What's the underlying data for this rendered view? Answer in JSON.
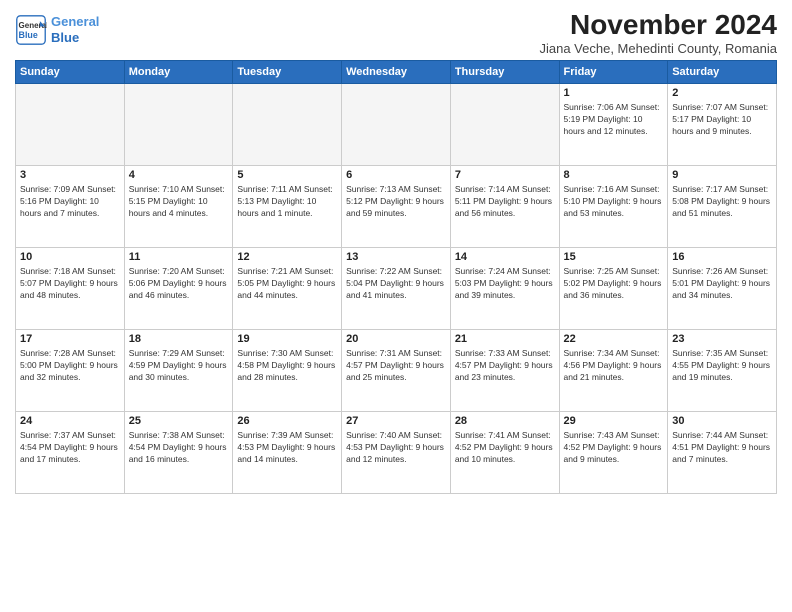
{
  "header": {
    "logo_line1": "General",
    "logo_line2": "Blue",
    "title": "November 2024",
    "location": "Jiana Veche, Mehedinti County, Romania"
  },
  "weekdays": [
    "Sunday",
    "Monday",
    "Tuesday",
    "Wednesday",
    "Thursday",
    "Friday",
    "Saturday"
  ],
  "weeks": [
    [
      {
        "day": "",
        "info": ""
      },
      {
        "day": "",
        "info": ""
      },
      {
        "day": "",
        "info": ""
      },
      {
        "day": "",
        "info": ""
      },
      {
        "day": "",
        "info": ""
      },
      {
        "day": "1",
        "info": "Sunrise: 7:06 AM\nSunset: 5:19 PM\nDaylight: 10 hours\nand 12 minutes."
      },
      {
        "day": "2",
        "info": "Sunrise: 7:07 AM\nSunset: 5:17 PM\nDaylight: 10 hours\nand 9 minutes."
      }
    ],
    [
      {
        "day": "3",
        "info": "Sunrise: 7:09 AM\nSunset: 5:16 PM\nDaylight: 10 hours\nand 7 minutes."
      },
      {
        "day": "4",
        "info": "Sunrise: 7:10 AM\nSunset: 5:15 PM\nDaylight: 10 hours\nand 4 minutes."
      },
      {
        "day": "5",
        "info": "Sunrise: 7:11 AM\nSunset: 5:13 PM\nDaylight: 10 hours\nand 1 minute."
      },
      {
        "day": "6",
        "info": "Sunrise: 7:13 AM\nSunset: 5:12 PM\nDaylight: 9 hours\nand 59 minutes."
      },
      {
        "day": "7",
        "info": "Sunrise: 7:14 AM\nSunset: 5:11 PM\nDaylight: 9 hours\nand 56 minutes."
      },
      {
        "day": "8",
        "info": "Sunrise: 7:16 AM\nSunset: 5:10 PM\nDaylight: 9 hours\nand 53 minutes."
      },
      {
        "day": "9",
        "info": "Sunrise: 7:17 AM\nSunset: 5:08 PM\nDaylight: 9 hours\nand 51 minutes."
      }
    ],
    [
      {
        "day": "10",
        "info": "Sunrise: 7:18 AM\nSunset: 5:07 PM\nDaylight: 9 hours\nand 48 minutes."
      },
      {
        "day": "11",
        "info": "Sunrise: 7:20 AM\nSunset: 5:06 PM\nDaylight: 9 hours\nand 46 minutes."
      },
      {
        "day": "12",
        "info": "Sunrise: 7:21 AM\nSunset: 5:05 PM\nDaylight: 9 hours\nand 44 minutes."
      },
      {
        "day": "13",
        "info": "Sunrise: 7:22 AM\nSunset: 5:04 PM\nDaylight: 9 hours\nand 41 minutes."
      },
      {
        "day": "14",
        "info": "Sunrise: 7:24 AM\nSunset: 5:03 PM\nDaylight: 9 hours\nand 39 minutes."
      },
      {
        "day": "15",
        "info": "Sunrise: 7:25 AM\nSunset: 5:02 PM\nDaylight: 9 hours\nand 36 minutes."
      },
      {
        "day": "16",
        "info": "Sunrise: 7:26 AM\nSunset: 5:01 PM\nDaylight: 9 hours\nand 34 minutes."
      }
    ],
    [
      {
        "day": "17",
        "info": "Sunrise: 7:28 AM\nSunset: 5:00 PM\nDaylight: 9 hours\nand 32 minutes."
      },
      {
        "day": "18",
        "info": "Sunrise: 7:29 AM\nSunset: 4:59 PM\nDaylight: 9 hours\nand 30 minutes."
      },
      {
        "day": "19",
        "info": "Sunrise: 7:30 AM\nSunset: 4:58 PM\nDaylight: 9 hours\nand 28 minutes."
      },
      {
        "day": "20",
        "info": "Sunrise: 7:31 AM\nSunset: 4:57 PM\nDaylight: 9 hours\nand 25 minutes."
      },
      {
        "day": "21",
        "info": "Sunrise: 7:33 AM\nSunset: 4:57 PM\nDaylight: 9 hours\nand 23 minutes."
      },
      {
        "day": "22",
        "info": "Sunrise: 7:34 AM\nSunset: 4:56 PM\nDaylight: 9 hours\nand 21 minutes."
      },
      {
        "day": "23",
        "info": "Sunrise: 7:35 AM\nSunset: 4:55 PM\nDaylight: 9 hours\nand 19 minutes."
      }
    ],
    [
      {
        "day": "24",
        "info": "Sunrise: 7:37 AM\nSunset: 4:54 PM\nDaylight: 9 hours\nand 17 minutes."
      },
      {
        "day": "25",
        "info": "Sunrise: 7:38 AM\nSunset: 4:54 PM\nDaylight: 9 hours\nand 16 minutes."
      },
      {
        "day": "26",
        "info": "Sunrise: 7:39 AM\nSunset: 4:53 PM\nDaylight: 9 hours\nand 14 minutes."
      },
      {
        "day": "27",
        "info": "Sunrise: 7:40 AM\nSunset: 4:53 PM\nDaylight: 9 hours\nand 12 minutes."
      },
      {
        "day": "28",
        "info": "Sunrise: 7:41 AM\nSunset: 4:52 PM\nDaylight: 9 hours\nand 10 minutes."
      },
      {
        "day": "29",
        "info": "Sunrise: 7:43 AM\nSunset: 4:52 PM\nDaylight: 9 hours\nand 9 minutes."
      },
      {
        "day": "30",
        "info": "Sunrise: 7:44 AM\nSunset: 4:51 PM\nDaylight: 9 hours\nand 7 minutes."
      }
    ]
  ]
}
